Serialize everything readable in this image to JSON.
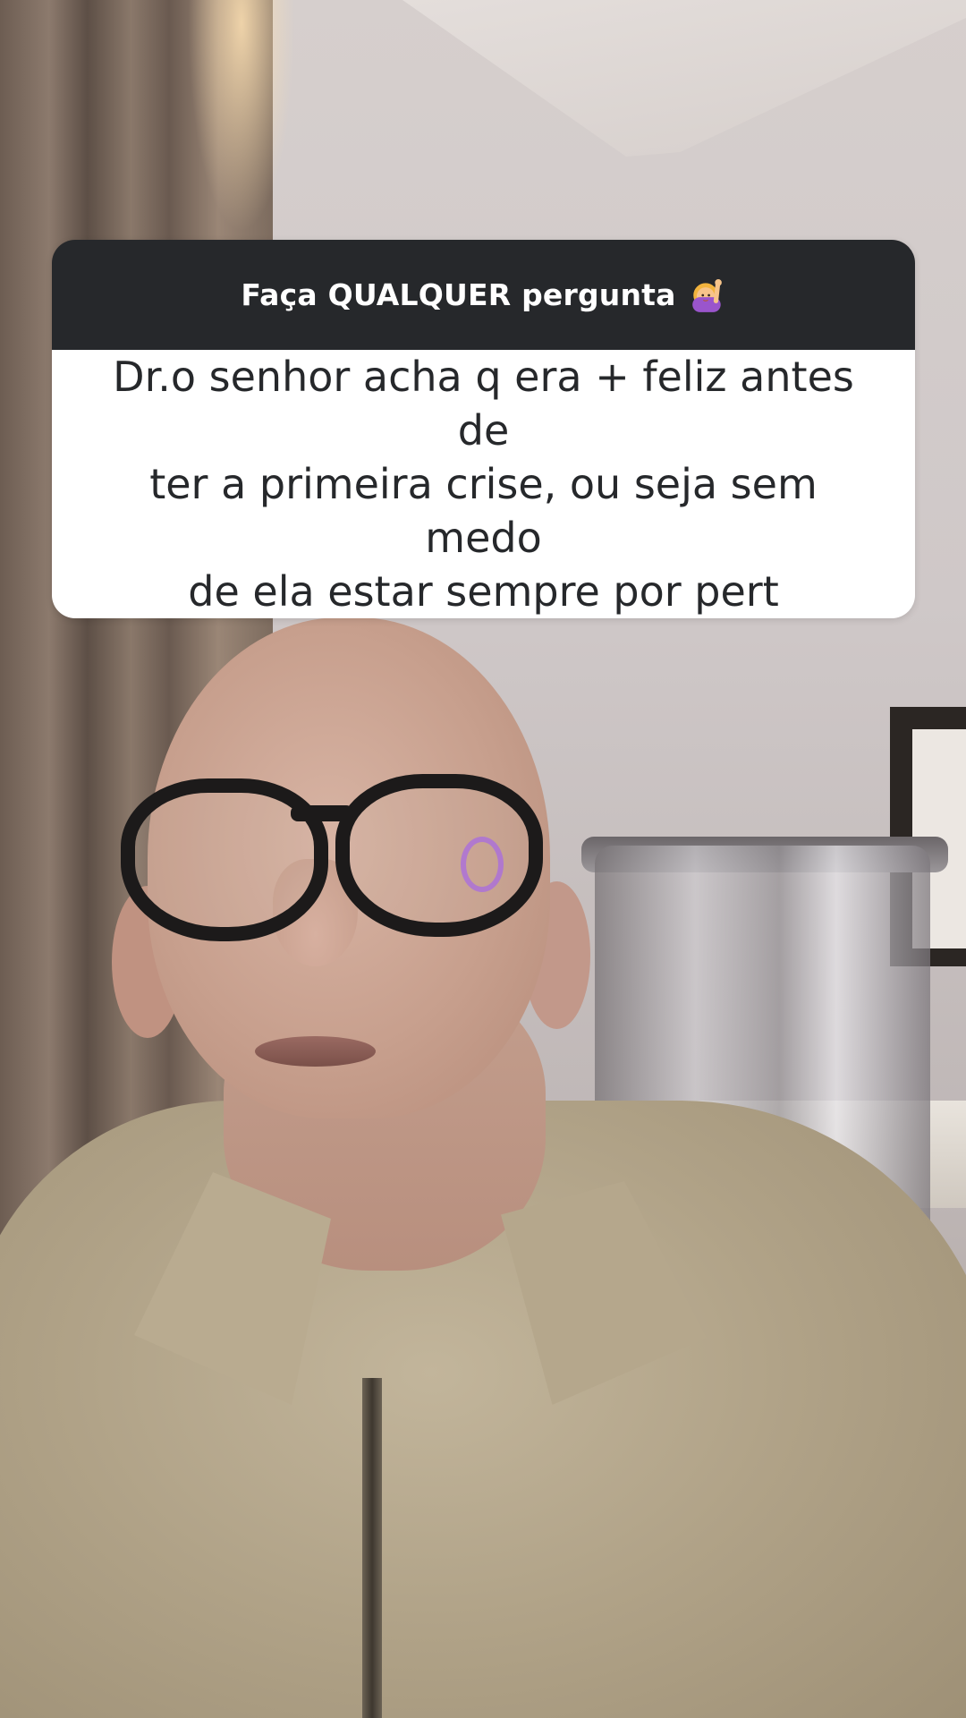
{
  "question_sticker": {
    "header_title": "Faça QUALQUER pergunta",
    "header_icon": "woman-raising-hand-emoji-icon",
    "question_lines": "Dr.o senhor acha q era + feliz antes de\nter a primeira crise, ou seja sem  medo\nde ela estar sempre por pert"
  },
  "colors": {
    "header_bg": "#26282b",
    "body_bg": "#ffffff",
    "question_text": "#26282b",
    "header_text": "#ffffff"
  }
}
